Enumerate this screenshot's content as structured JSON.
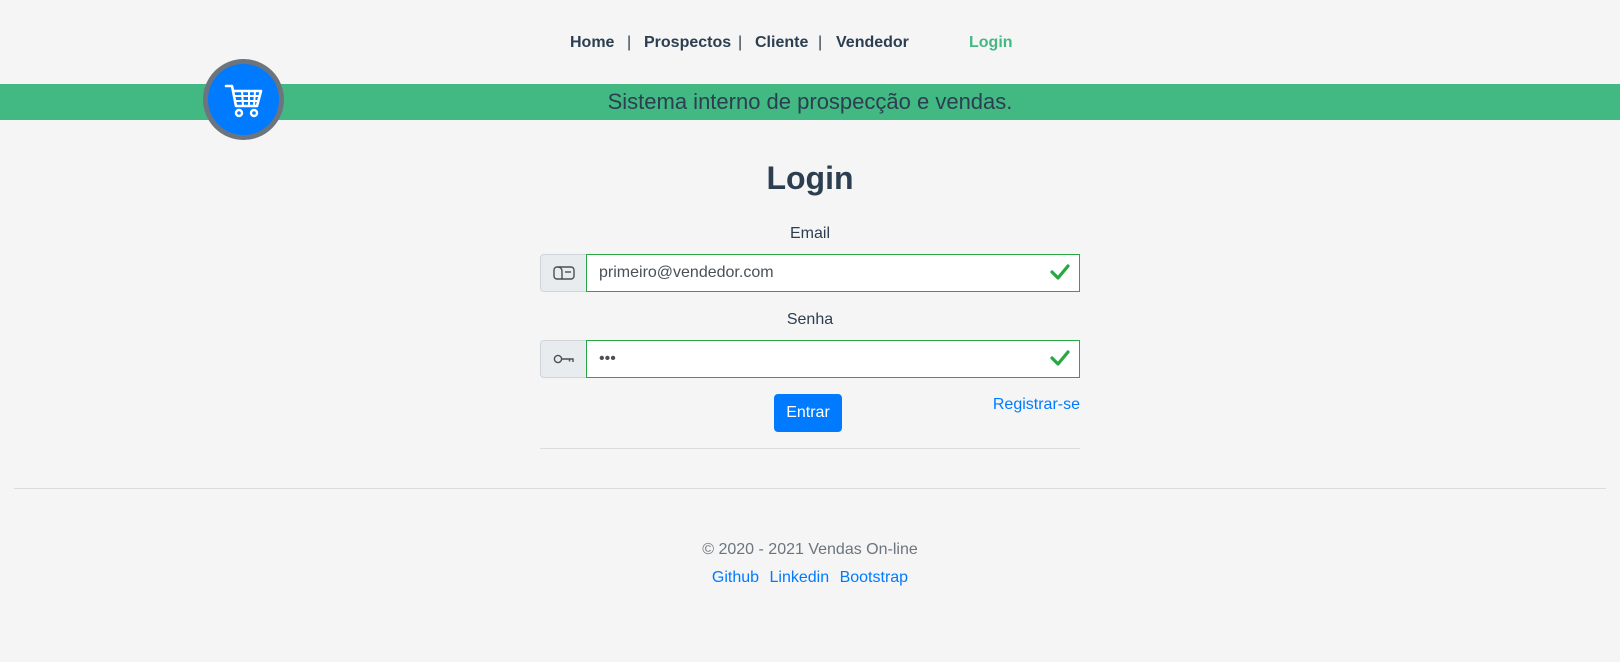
{
  "nav": {
    "home": "Home",
    "prospectos": "Prospectos",
    "cliente": "Cliente",
    "vendedor": "Vendedor",
    "login": "Login",
    "separator": "|"
  },
  "banner": {
    "text": "Sistema interno de prospecção e vendas."
  },
  "logo": {
    "icon": "shopping-cart-icon"
  },
  "form": {
    "title": "Login",
    "email_label": "Email",
    "email_value": "primeiro@vendedor.com",
    "password_label": "Senha",
    "password_value": "123",
    "submit_label": "Entrar",
    "register_label": "Registrar-se"
  },
  "footer": {
    "copyright": "© 2020 - 2021 Vendas On-line",
    "links": [
      "Github",
      "Linkedin",
      "Bootstrap"
    ]
  },
  "colors": {
    "accent_green": "#42b983",
    "primary_blue": "#007bff",
    "valid_green": "#28a745",
    "text_dark": "#2c3e50"
  }
}
